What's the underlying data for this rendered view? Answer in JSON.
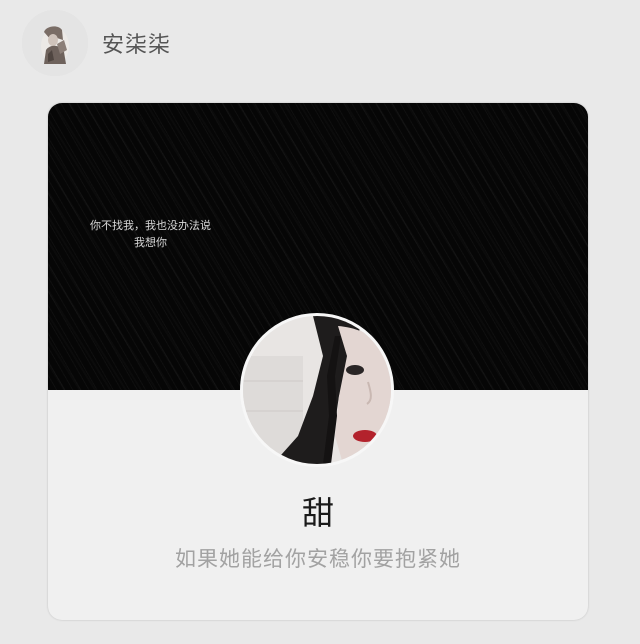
{
  "header": {
    "username": "安柒柒"
  },
  "card": {
    "cover_caption_line1": "你不找我，我也没办法说",
    "cover_caption_line2": "我想你",
    "nickname": "甜",
    "signature": "如果她能给你安稳你要抱紧她"
  },
  "colors": {
    "background": "#e9e9e9",
    "card": "#f0f0f0",
    "cover": "#060606",
    "name_text": "#1a1a1a",
    "signature_text": "#a2a2a2"
  },
  "icons": {
    "header_avatar": "user-avatar-photo",
    "profile_avatar": "profile-avatar-photo"
  }
}
